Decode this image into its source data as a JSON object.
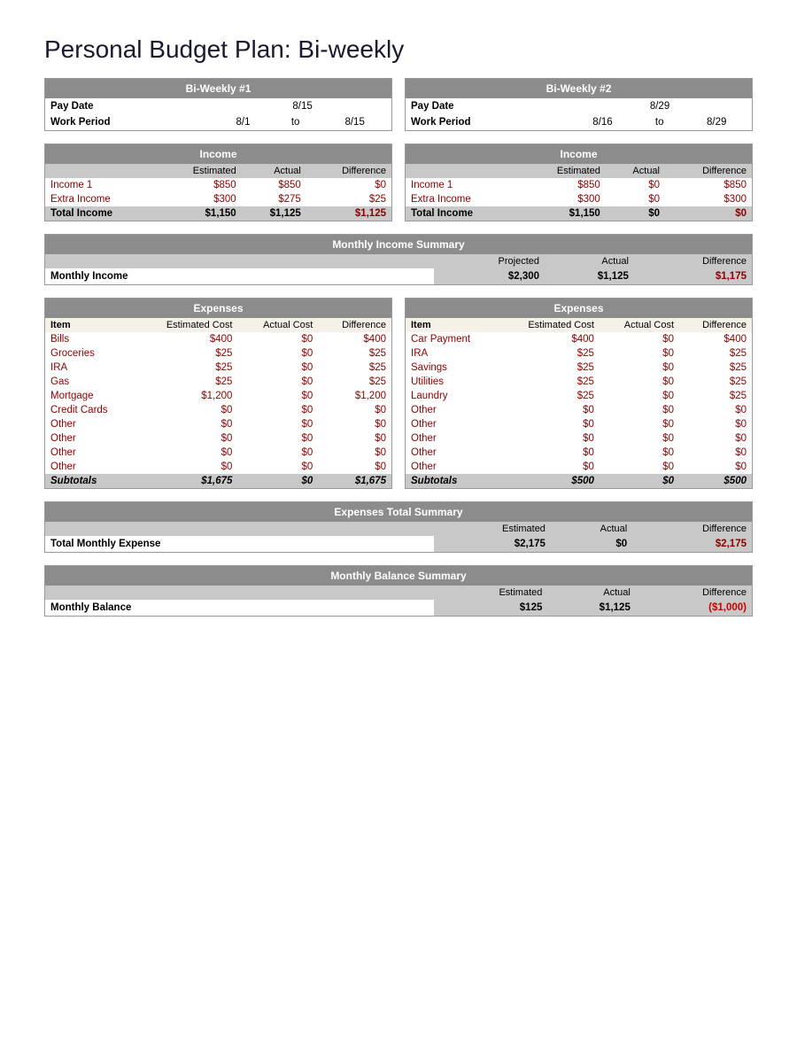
{
  "title": "Personal Budget Plan: Bi-weekly",
  "biweekly1": {
    "header": "Bi-Weekly #1",
    "payDateLabel": "Pay Date",
    "payDateValue": "8/15",
    "workPeriodLabel": "Work Period",
    "workPeriodStart": "8/1",
    "workPeriodTo": "to",
    "workPeriodEnd": "8/15",
    "incomeHeader": "Income",
    "colEstimated": "Estimated",
    "colActual": "Actual",
    "colDifference": "Difference",
    "income1Label": "Income 1",
    "income1Est": "$850",
    "income1Act": "$850",
    "income1Diff": "$0",
    "extraIncomeLabel": "Extra Income",
    "extraIncomeEst": "$300",
    "extraIncomeAct": "$275",
    "extraIncomeDiff": "$25",
    "totalIncomeLabel": "Total Income",
    "totalIncomeEst": "$1,150",
    "totalIncomeAct": "$1,125",
    "totalIncomeDiff": "$1,125"
  },
  "biweekly2": {
    "header": "Bi-Weekly #2",
    "payDateLabel": "Pay Date",
    "payDateValue": "8/29",
    "workPeriodLabel": "Work Period",
    "workPeriodStart": "8/16",
    "workPeriodTo": "to",
    "workPeriodEnd": "8/29",
    "incomeHeader": "Income",
    "colEstimated": "Estimated",
    "colActual": "Actual",
    "colDifference": "Difference",
    "income1Label": "Income 1",
    "income1Est": "$850",
    "income1Act": "$0",
    "income1Diff": "$850",
    "extraIncomeLabel": "Extra Income",
    "extraIncomeEst": "$300",
    "extraIncomeAct": "$0",
    "extraIncomeDiff": "$300",
    "totalIncomeLabel": "Total Income",
    "totalIncomeEst": "$1,150",
    "totalIncomeAct": "$0",
    "totalIncomeDiff": "$0"
  },
  "monthlyIncomeSummary": {
    "header": "Monthly Income Summary",
    "colProjected": "Projected",
    "colActual": "Actual",
    "colDifference": "Difference",
    "rowLabel": "Monthly Income",
    "projected": "$2,300",
    "actual": "$1,125",
    "difference": "$1,175"
  },
  "expenses1": {
    "header": "Expenses",
    "colItem": "Item",
    "colEstCost": "Estimated Cost",
    "colActCost": "Actual Cost",
    "colDiff": "Difference",
    "rows": [
      {
        "item": "Bills",
        "est": "$400",
        "act": "$0",
        "diff": "$400"
      },
      {
        "item": "Groceries",
        "est": "$25",
        "act": "$0",
        "diff": "$25"
      },
      {
        "item": "IRA",
        "est": "$25",
        "act": "$0",
        "diff": "$25"
      },
      {
        "item": "Gas",
        "est": "$25",
        "act": "$0",
        "diff": "$25"
      },
      {
        "item": "Mortgage",
        "est": "$1,200",
        "act": "$0",
        "diff": "$1,200"
      },
      {
        "item": "Credit Cards",
        "est": "$0",
        "act": "$0",
        "diff": "$0"
      },
      {
        "item": "Other",
        "est": "$0",
        "act": "$0",
        "diff": "$0"
      },
      {
        "item": "Other",
        "est": "$0",
        "act": "$0",
        "diff": "$0"
      },
      {
        "item": "Other",
        "est": "$0",
        "act": "$0",
        "diff": "$0"
      },
      {
        "item": "Other",
        "est": "$0",
        "act": "$0",
        "diff": "$0"
      }
    ],
    "subtotalLabel": "Subtotals",
    "subtotalEst": "$1,675",
    "subtotalAct": "$0",
    "subtotalDiff": "$1,675"
  },
  "expenses2": {
    "header": "Expenses",
    "colItem": "Item",
    "colEstCost": "Estimated Cost",
    "colActCost": "Actual Cost",
    "colDiff": "Difference",
    "rows": [
      {
        "item": "Car Payment",
        "est": "$400",
        "act": "$0",
        "diff": "$400"
      },
      {
        "item": "IRA",
        "est": "$25",
        "act": "$0",
        "diff": "$25"
      },
      {
        "item": "Savings",
        "est": "$25",
        "act": "$0",
        "diff": "$25"
      },
      {
        "item": "Utilities",
        "est": "$25",
        "act": "$0",
        "diff": "$25"
      },
      {
        "item": "Laundry",
        "est": "$25",
        "act": "$0",
        "diff": "$25"
      },
      {
        "item": "Other",
        "est": "$0",
        "act": "$0",
        "diff": "$0"
      },
      {
        "item": "Other",
        "est": "$0",
        "act": "$0",
        "diff": "$0"
      },
      {
        "item": "Other",
        "est": "$0",
        "act": "$0",
        "diff": "$0"
      },
      {
        "item": "Other",
        "est": "$0",
        "act": "$0",
        "diff": "$0"
      },
      {
        "item": "Other",
        "est": "$0",
        "act": "$0",
        "diff": "$0"
      }
    ],
    "subtotalLabel": "Subtotals",
    "subtotalEst": "$500",
    "subtotalAct": "$0",
    "subtotalDiff": "$500"
  },
  "expensesTotalSummary": {
    "header": "Expenses Total Summary",
    "colEstimated": "Estimated",
    "colActual": "Actual",
    "colDifference": "Difference",
    "rowLabel": "Total Monthly Expense",
    "estimated": "$2,175",
    "actual": "$0",
    "difference": "$2,175"
  },
  "monthlyBalanceSummary": {
    "header": "Monthly Balance Summary",
    "colEstimated": "Estimated",
    "colActual": "Actual",
    "colDifference": "Difference",
    "rowLabel": "Monthly Balance",
    "estimated": "$125",
    "actual": "$1,125",
    "difference": "($1,000)"
  }
}
